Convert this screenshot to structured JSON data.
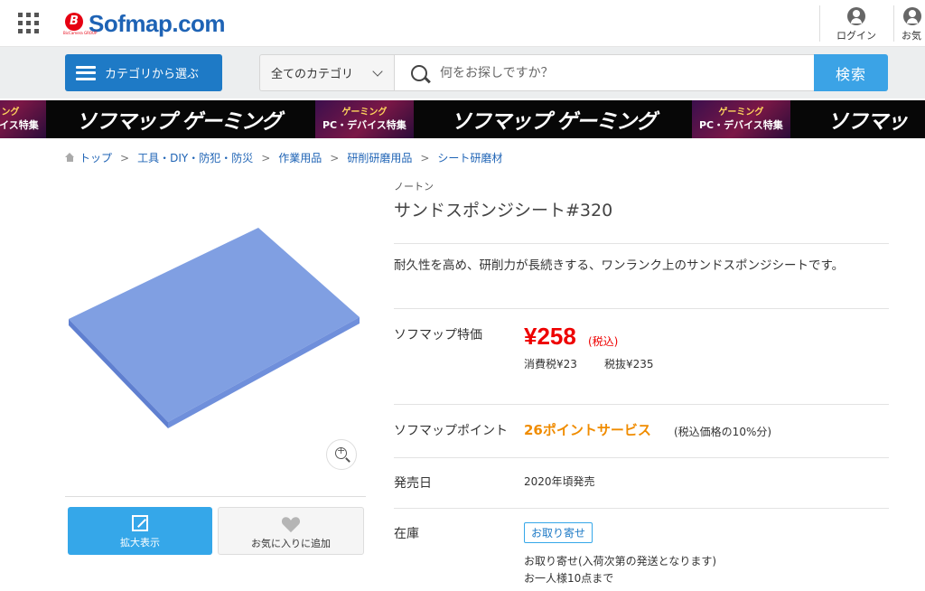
{
  "header": {
    "logo_text": "Sofmap.com",
    "logo_mark": "B",
    "logo_sub": "BicCamera GROUP",
    "login_label": "ログイン",
    "fav_label": "お気",
    "icons": [
      "apps-grid-icon",
      "user-icon",
      "heart-icon"
    ]
  },
  "search": {
    "category_button": "カテゴリから選ぶ",
    "category_select": "全てのカテゴリ",
    "placeholder": "何をお探しですか？",
    "submit": "検索"
  },
  "banner": {
    "tag_top": "ゲーミング",
    "tag_bottom": "PC・デバイス特集",
    "logo": "ソフマップ ゲーミング",
    "edge_logo": "ソフマッ"
  },
  "breadcrumb": [
    "トップ",
    "工具・DIY・防犯・防災",
    "作業用品",
    "研削研磨用品",
    "シート研磨材"
  ],
  "product": {
    "maker": "ノートン",
    "name": "サンドスポンジシート#320",
    "description": "耐久性を高め、研削力が長続きする、ワンランク上のサンドスポンジシートです。",
    "image_color": "#7e9fe3"
  },
  "price": {
    "label": "ソフマップ特価",
    "value": "¥258",
    "tax_included": "(税込)",
    "consumption_tax": "消費税¥23",
    "tax_excluded": "税抜¥235",
    "color": "#e00000"
  },
  "points": {
    "label": "ソフマップポイント",
    "value": "26ポイントサービス",
    "note": "(税込価格の10%分)",
    "color": "#f08c00"
  },
  "release": {
    "label": "発売日",
    "value": "2020年頃発売"
  },
  "stock": {
    "label": "在庫",
    "badge": "お取り寄せ",
    "note1": "お取り寄せ(入荷次第の発送となります)",
    "note2": "お一人様10点まで"
  },
  "image_actions": {
    "enlarge": "拡大表示",
    "favorite": "お気に入りに追加"
  }
}
